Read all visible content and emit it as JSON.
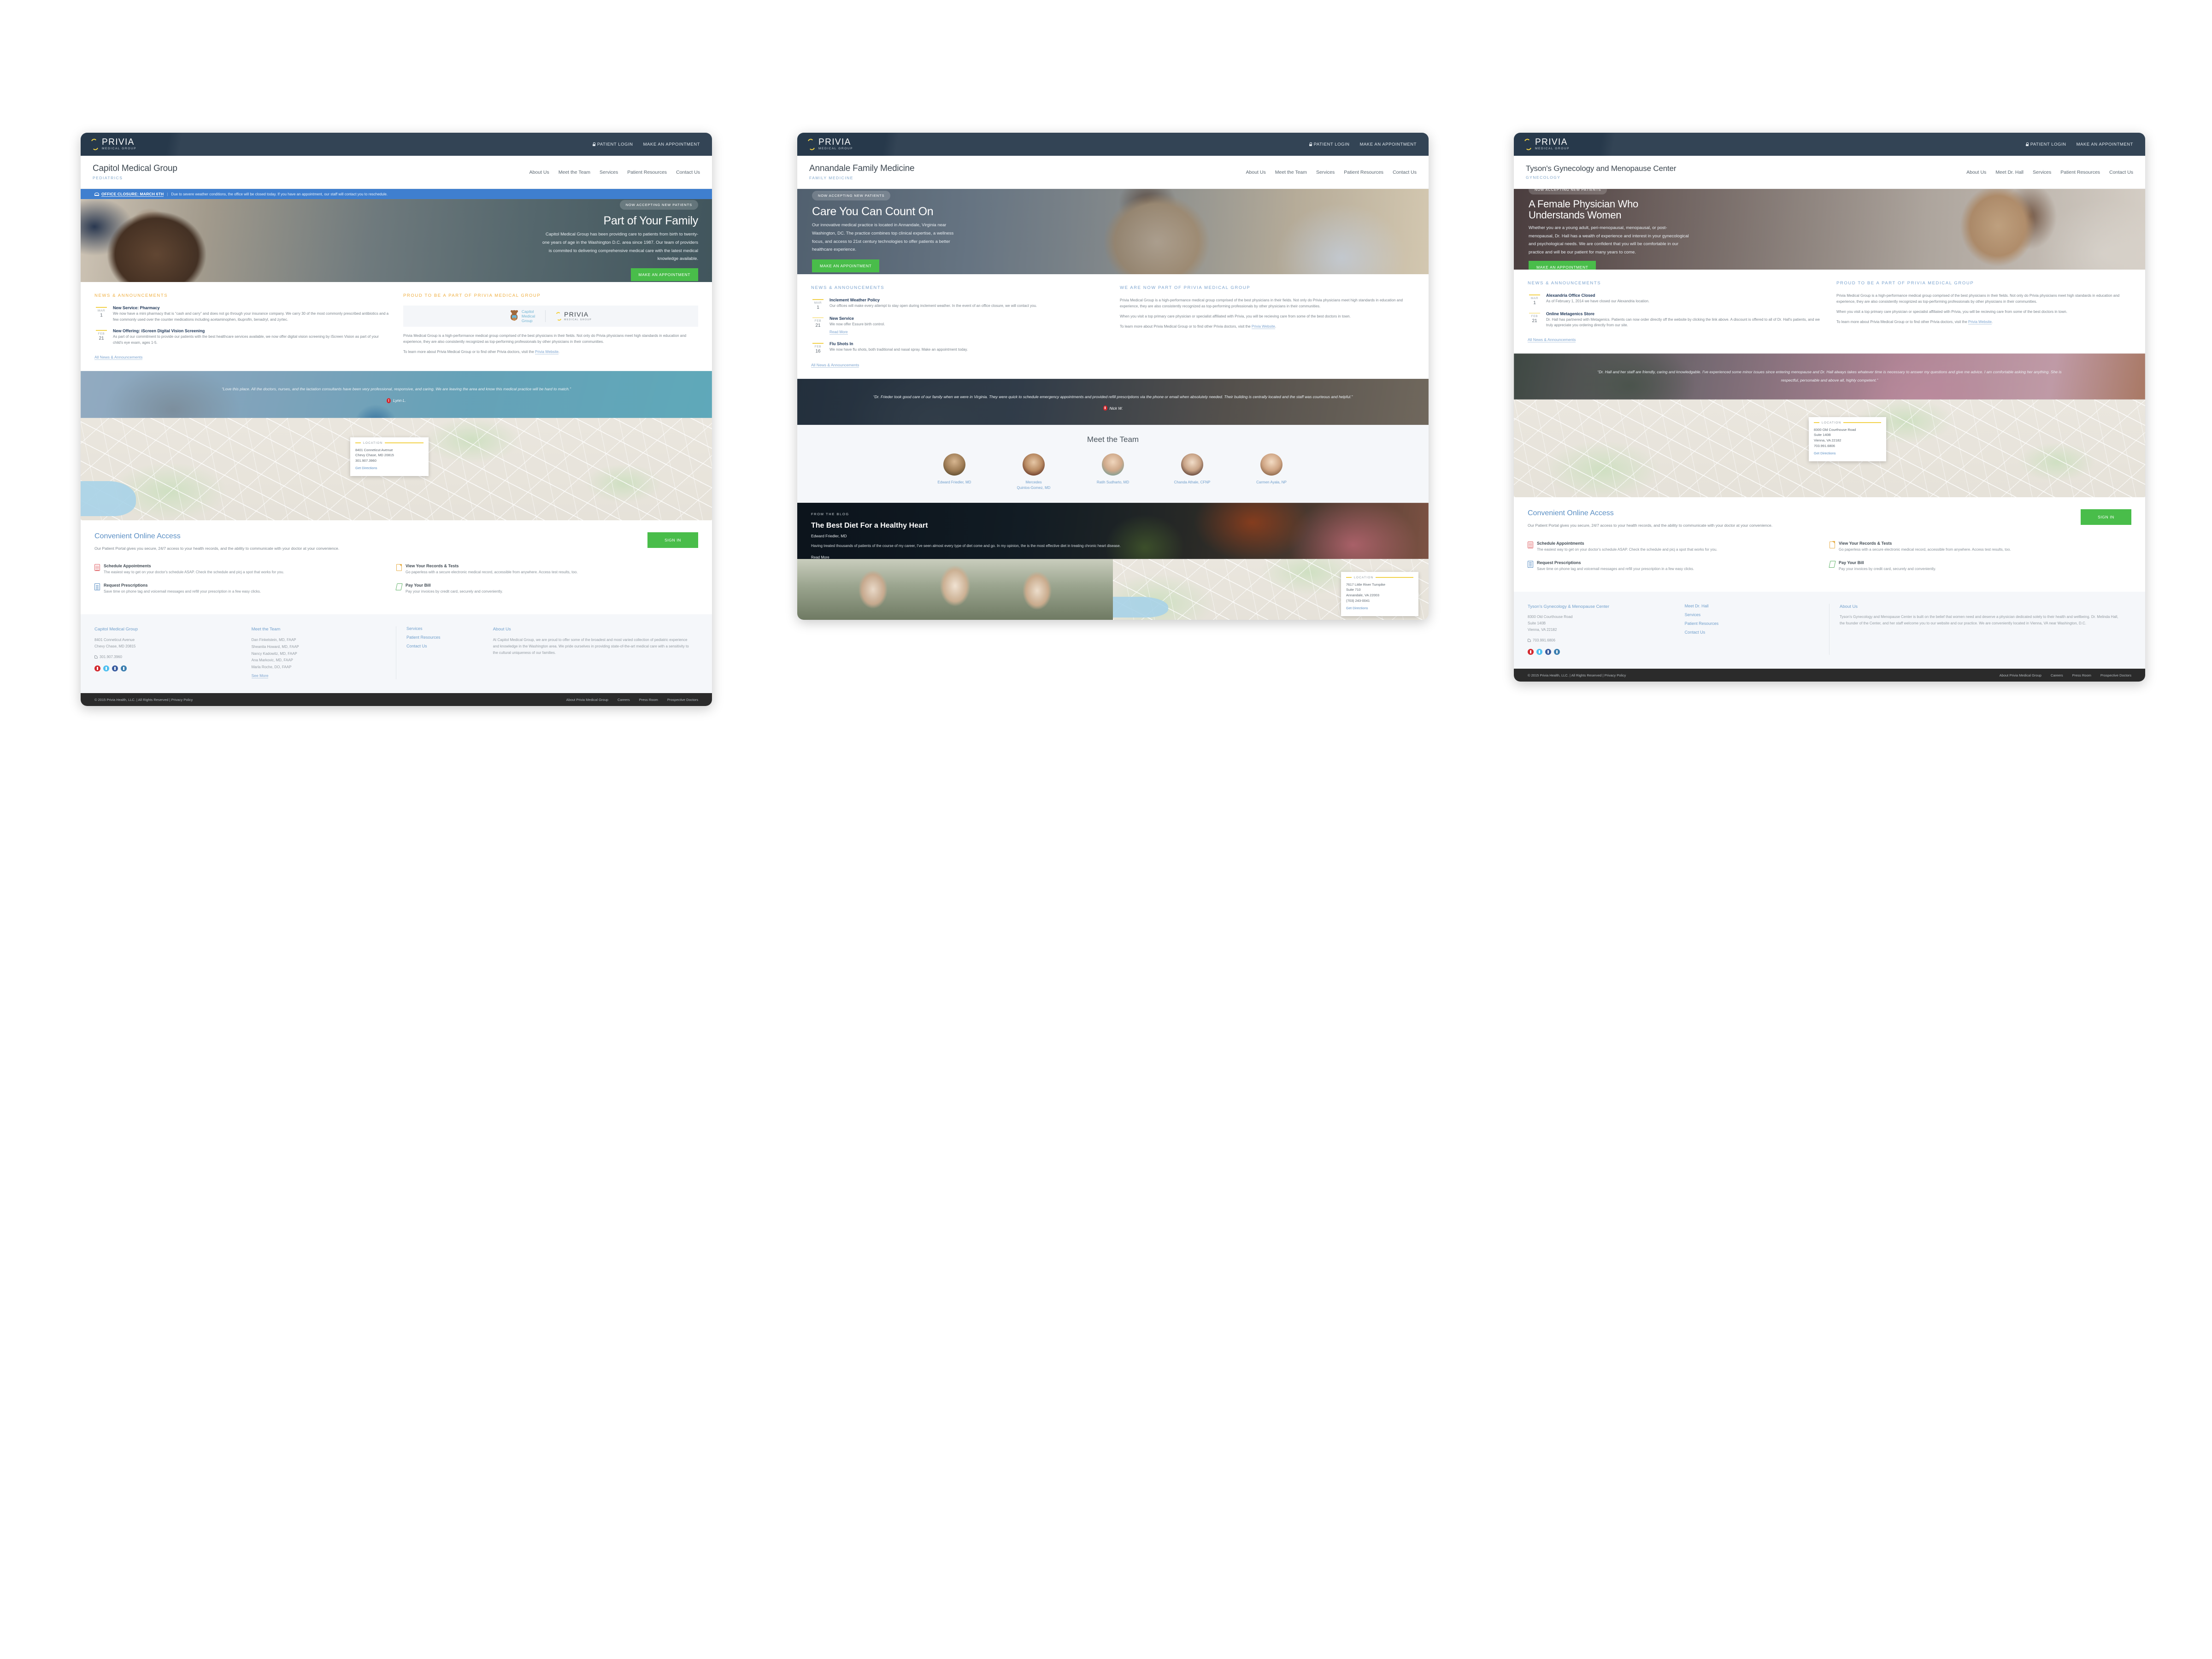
{
  "shared": {
    "privia_logo": {
      "name": "PRIVIA",
      "sub": "MEDICAL GROUP"
    },
    "topbar": {
      "patient_login": "PATIENT LOGIN",
      "make_appointment": "MAKE AN APPOINTMENT"
    },
    "badge_new_patients": "NOW ACCEPTING NEW PATIENTS",
    "cta_make_appointment": "MAKE AN APPOINTMENT",
    "all_news": "All News & Announcements",
    "read_more": "Read More",
    "location_label": "LOCATION",
    "get_directions": "Get Directions",
    "privia_blurb_p1": "Privia Medical Group is a high-performance medical group comprised of the best physicians in their fields. Not only do Privia physicians meet high standards in education and experience, they are also consistently recognized as top-performing professionals by other physicians in their communities.",
    "privia_blurb_p2_pre": "To learn more about Privia Medical Group or to find other Privia doctors, visit the ",
    "privia_blurb_link": "Privia Website",
    "coa": {
      "title": "Convenient Online Access",
      "lead": "Our Patient Portal gives you secure, 24/7 access to your health records, and the ability to communicate with your doctor at your convenience.",
      "signin": "SIGN IN",
      "features": [
        {
          "title": "Schedule Appointments",
          "desc": "The easiest way to get on your doctor's schedule ASAP. Check the schedule and picj a spot that works for you.",
          "icon": "calendar-icon"
        },
        {
          "title": "View Your Records & Tests",
          "desc": "Go paperless with a secure electronic medical record, accessible from anywhere. Access test results, too.",
          "icon": "document-icon"
        },
        {
          "title": "Request Prescriptions",
          "desc": "Save time on phone tag and voicemail messages and refill your prescription in a few easy clicks.",
          "icon": "prescription-icon"
        },
        {
          "title": "Pay Your Bill",
          "desc": "Pay your invoices by credit card, securely and conveniently.",
          "icon": "payment-icon"
        }
      ]
    },
    "footer_bar": {
      "copyright": "© 2015 Privia Health, LLC. | All Rights Reserved | Privacy Policy",
      "links": [
        "About Privia Medical Group",
        "Careers",
        "Press Room",
        "Prospective Doctors"
      ]
    }
  },
  "panel1": {
    "practice_name": "Capitol Medical Group",
    "specialty": "PEDIATRICS",
    "nav": [
      "About Us",
      "Meet the Team",
      "Services",
      "Patient Resources",
      "Contact Us"
    ],
    "alert": {
      "title": "OFFICE CLOSURE: MARCH 6TH",
      "sep": "|",
      "text": "Due to severe weather conditions, the office will be closed today. If you have an appointment, our staff will contact you to reschedule."
    },
    "hero": {
      "title": "Part of Your Family",
      "body": "Capitol Medical Group has been providing care to patients from birth to twenty-one years of age in the Washington D.C. area since 1987. Our team of providers is commited to delivering comprehensive medical care with the latest medical knowledge available."
    },
    "news_title": "NEWS & ANNOUNCEMENTS",
    "news": [
      {
        "month": "MAR",
        "day": "1",
        "title": "New Service: Pharmacy",
        "text": "We now have a mini pharmacy that is “cash and carry” and does not go through your insurance company. We carry 30 of the most commonly prescribed antibiotics and a few commonly used over the counter medications including acetaminophen, ibuprofin, benadryl, and zyrtec."
      },
      {
        "month": "FEB",
        "day": "21",
        "title": "New Offering: iScreen Digital Vision Screening",
        "text": "As part of our commitment to provide our patients with the best healthcare services available, we now offer digital vision screening by iScreen Vision as part of your child's eye exam, ages 1-5."
      }
    ],
    "privia_title": "PROUD TO BE A PART OF PRIVIA MEDICAL GROUP",
    "cobrand": {
      "name_line1": "Capitol",
      "name_line2": "Medical",
      "name_line3": "Group"
    },
    "testimonial": {
      "quote": "“Love this place. All the doctors, nurses, and the lactation consultants have been very professional, responsive, and caring. We are leaving the area and know this medical practice will be hard to match.”",
      "author": "Lynn L."
    },
    "location": {
      "line1": "8401 Conneticut Avenue",
      "line2": "Chevy Chase, MD 20815",
      "phone": "301.907.3960"
    },
    "footer": {
      "col1_title": "Capitol Medical Group",
      "address": [
        "8401 Conneticut Avenue",
        "Chevy Chase, MD 20815"
      ],
      "phone": "301.907.3960",
      "col2_title": "Meet the Team",
      "team": [
        "Dan Finkelstein, MD, FAAP",
        "Sheanita Howard, MD, FAAP",
        "Nancy Kadowitz, MD, FAAP",
        "Ana Markovic, MD, FAAP",
        "Marla Roche, DO, FAAP"
      ],
      "see_more": "See More",
      "links": [
        "Services",
        "Patient Resources",
        "Contact Us"
      ],
      "about_title": "About Us",
      "about_text": "At Capitol Medical Group, we are proud to offer some of the broadest and most varied collection of pediatric experience and knowledge in the Washington area. We pride ourselves in providing state-of-the-art medical care with a sensitivity to the cultural uniqueness of our families."
    }
  },
  "panel2": {
    "practice_name": "Annandale Family Medicine",
    "specialty": "FAMILY MEDICINE",
    "nav": [
      "About Us",
      "Meet the Team",
      "Services",
      "Patient Resources",
      "Contact Us"
    ],
    "hero": {
      "title": "Care You Can Count On",
      "body": "Our innovative medical practice is located in Annandale, Virginia near Washington, DC. The practice combines top clinical expertise, a wellness focus, and access to 21st century technologies to offer patients a better healthcare experience."
    },
    "news_title": "NEWS & ANNOUNCEMENTS",
    "news": [
      {
        "month": "MAR",
        "day": "1",
        "title": "Inclement Weather Policy",
        "text": "Our offices will make every attempt to stay open during inclement weather. In the event of an office closure, we will contact you."
      },
      {
        "month": "FEB",
        "day": "21",
        "title": "New Service",
        "text": "We now offer Essure birth control."
      },
      {
        "month": "FEB",
        "day": "16",
        "title": "Flu Shots In",
        "text": "We now have flu shots, both traditional and nasal spray. Make an appointment today."
      }
    ],
    "privia_title": "WE ARE NOW PART OF PRIVIA MEDICAL GROUP",
    "testimonial": {
      "quote": "“Dr. Frieder took good care of our family when we were in Virginia. They were quick to schedule emergency appointments and provided refill prescriptions via the phone or email when absolutely needed. Their building is centrally located and the staff was courteous and helpful.”",
      "author": "Nick W."
    },
    "team_title": "Meet the Team",
    "team": [
      {
        "name": "Edward Friedler, MD"
      },
      {
        "name": "Mercedes\nQuintos-Gomez, MD"
      },
      {
        "name": "Ratih Sudharto, MD"
      },
      {
        "name": "Chanda Athale, CFNP"
      },
      {
        "name": "Carmen Ayala, NP"
      }
    ],
    "blog": {
      "kicker": "FROM THE BLOG",
      "title": "The Best Diet For a Healthy Heart",
      "author": "Edward Friedler, MD",
      "text": "Having treated thousands of patients of the course of my career, I've seen almost every type of diet come and go. In my opinion, the is the most effective diet in treating chronic heart disease.",
      "read_more": "Read More"
    },
    "location": {
      "line1": "7617 Little River Turnpike",
      "line2": "Suite 710",
      "line3": "Annandale, VA 22003",
      "phone": "(703) 243-0041"
    }
  },
  "panel3": {
    "practice_name": "Tyson's Gynecology and Menopause Center",
    "specialty": "GYNECOLOGY",
    "nav": [
      "About Us",
      "Meet Dr. Hall",
      "Services",
      "Patient Resources",
      "Contact Us"
    ],
    "hero": {
      "title_l1": "A Female Physician Who",
      "title_l2": "Understands Women",
      "body": "Whether you are a young adult, peri-menopausal, menopausal, or post-menopausal, Dr. Hall has a wealth of experience and interest in your gynecological and psychological needs. We are confident that you will be comfortable in our practice and will be our patient for many years to come."
    },
    "news_title": "NEWS & ANNOUNCEMENTS",
    "news": [
      {
        "month": "MAR",
        "day": "1",
        "title": "Alexandria Office Closed",
        "text": "As of February 1, 2014 we have closed our Alexandria location."
      },
      {
        "month": "FEB",
        "day": "21",
        "title": "Online Metagenics Store",
        "text": "Dr. Hall has partnered with Metagenics. Patients can now order directly off the website by clicking the link above. A discount is offered to all of Dr. Hall's patients, and we truly appreciate you ordering directly from our site."
      }
    ],
    "privia_title": "PROUD TO BE A PART OF PRIVIA MEDICAL GROUP",
    "testimonial": {
      "quote": "“Dr. Hall and her staff are friendly, caring and knowledgable. I've experienced some minor issues since entering menopause and Dr. Hall always takes whatever time is necessary to answer my questions and give me advice. I am comfortable asking her anything. She is respectful, personable and above all, highly competent.”"
    },
    "location": {
      "line1": "8300 Old Courthouse Road",
      "line2": "Suite 140B",
      "line3": "Vienna, VA 22182",
      "phone": "703.991.6806"
    },
    "footer": {
      "col1_title": "Tyson's Gynecology & Menopause Center",
      "address": [
        "8300 Old Courthouse Road",
        "Suite 140B",
        "Vienna, VA 22182"
      ],
      "phone": "703.991.6806",
      "links": [
        "Meet Dr. Hall",
        "Services",
        "Patient Resources",
        "Contact Us"
      ],
      "about_title": "About Us",
      "about_text": "Tyson's Gynecology and Menopause Center is built on the belief that women need and deserve a physician dedicated solely to their health and wellbeing. Dr. Melinda Hall, the founder of the Center, and her staff welcome you to our website and our practice. We are conveniently located in Vienna, VA near Washington, D.C."
    }
  }
}
